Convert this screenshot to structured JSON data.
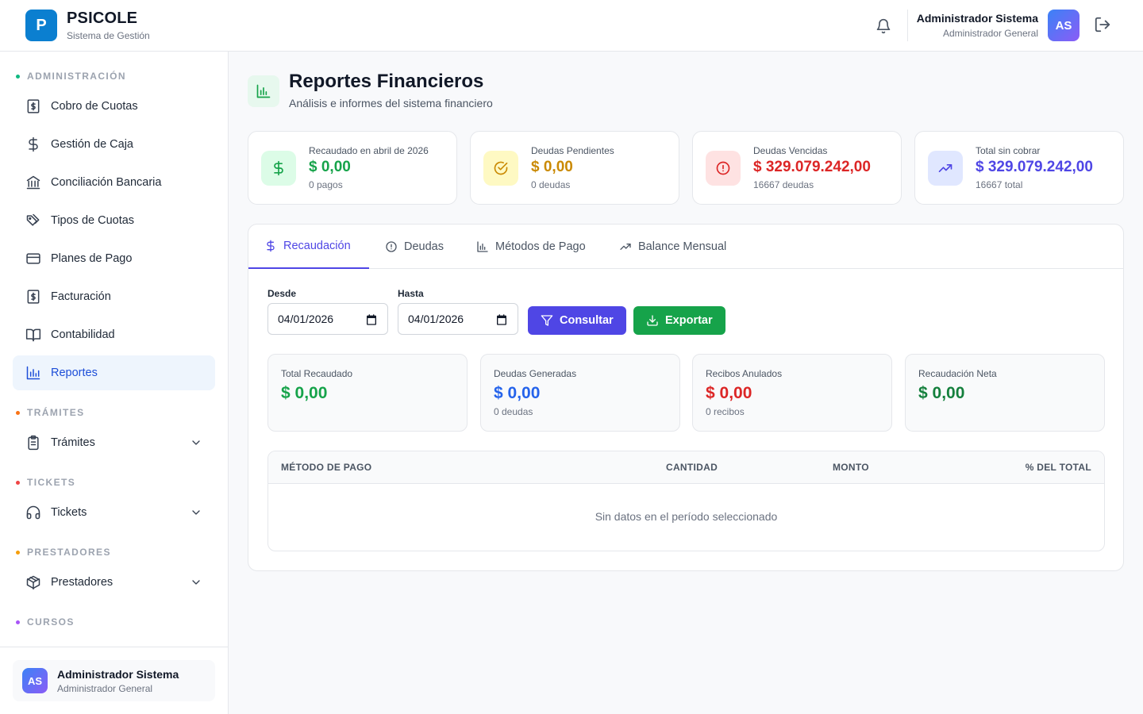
{
  "brand": {
    "logo_letter": "P",
    "name": "PSICOLE",
    "subtitle": "Sistema de Gestión"
  },
  "header": {
    "user_name": "Administrador Sistema",
    "user_role": "Administrador General",
    "avatar_initials": "AS"
  },
  "sidebar": {
    "sections": [
      {
        "title": "ADMINISTRACIÓN",
        "color": "#10b981"
      },
      {
        "title": "TRÁMITES",
        "color": "#f97316"
      },
      {
        "title": "TICKETS",
        "color": "#ef4444"
      },
      {
        "title": "PRESTADORES",
        "color": "#f59e0b"
      },
      {
        "title": "CURSOS",
        "color": "#a855f7"
      }
    ],
    "items": [
      {
        "label": "Cobro de Cuotas",
        "icon": "receipt-dollar-icon"
      },
      {
        "label": "Gestión de Caja",
        "icon": "dollar-icon"
      },
      {
        "label": "Conciliación Bancaria",
        "icon": "bank-icon"
      },
      {
        "label": "Tipos de Cuotas",
        "icon": "tags-icon"
      },
      {
        "label": "Planes de Pago",
        "icon": "credit-card-icon"
      },
      {
        "label": "Facturación",
        "icon": "receipt-dollar-icon"
      },
      {
        "label": "Contabilidad",
        "icon": "book-icon"
      },
      {
        "label": "Reportes",
        "icon": "bar-chart-icon",
        "active": true
      },
      {
        "label": "Trámites",
        "icon": "clipboard-icon"
      },
      {
        "label": "Tickets",
        "icon": "headphones-icon"
      },
      {
        "label": "Prestadores",
        "icon": "package-icon"
      }
    ],
    "footer_user": {
      "name": "Administrador Sistema",
      "role": "Administrador General",
      "initials": "AS"
    }
  },
  "page": {
    "title": "Reportes Financieros",
    "subtitle": "Análisis e informes del sistema financiero"
  },
  "stats": [
    {
      "label": "Recaudado en abril de 2026",
      "value": "$ 0,00",
      "sub": "0 pagos",
      "color": "#16a34a",
      "bg": "#dcfce7",
      "icon": "dollar-icon"
    },
    {
      "label": "Deudas Pendientes",
      "value": "$ 0,00",
      "sub": "0 deudas",
      "color": "#ca8a04",
      "bg": "#fef9c3",
      "icon": "check-circle-icon"
    },
    {
      "label": "Deudas Vencidas",
      "value": "$ 329.079.242,00",
      "sub": "16667 deudas",
      "color": "#dc2626",
      "bg": "#fee2e2",
      "icon": "alert-circle-icon"
    },
    {
      "label": "Total sin cobrar",
      "value": "$ 329.079.242,00",
      "sub": "16667 total",
      "color": "#4f46e5",
      "bg": "#e0e7ff",
      "icon": "trending-up-icon"
    }
  ],
  "tabs": [
    {
      "label": "Recaudación",
      "icon": "dollar-icon",
      "active": true
    },
    {
      "label": "Deudas",
      "icon": "alert-circle-icon"
    },
    {
      "label": "Métodos de Pago",
      "icon": "bar-chart-icon"
    },
    {
      "label": "Balance Mensual",
      "icon": "trending-up-icon"
    }
  ],
  "filters": {
    "from_label": "Desde",
    "from_value": "04/01/2026",
    "to_label": "Hasta",
    "to_value": "04/01/2026",
    "query_button": "Consultar",
    "export_button": "Exportar"
  },
  "summary": [
    {
      "label": "Total Recaudado",
      "value": "$ 0,00",
      "sub": "",
      "color": "#16a34a"
    },
    {
      "label": "Deudas Generadas",
      "value": "$ 0,00",
      "sub": "0 deudas",
      "color": "#2563eb"
    },
    {
      "label": "Recibos Anulados",
      "value": "$ 0,00",
      "sub": "0 recibos",
      "color": "#dc2626"
    },
    {
      "label": "Recaudación Neta",
      "value": "$ 0,00",
      "sub": "",
      "color": "#15803d"
    }
  ],
  "table": {
    "columns": [
      "MÉTODO DE PAGO",
      "CANTIDAD",
      "MONTO",
      "% DEL TOTAL"
    ],
    "rows": [],
    "empty_text": "Sin datos en el período seleccionado"
  }
}
